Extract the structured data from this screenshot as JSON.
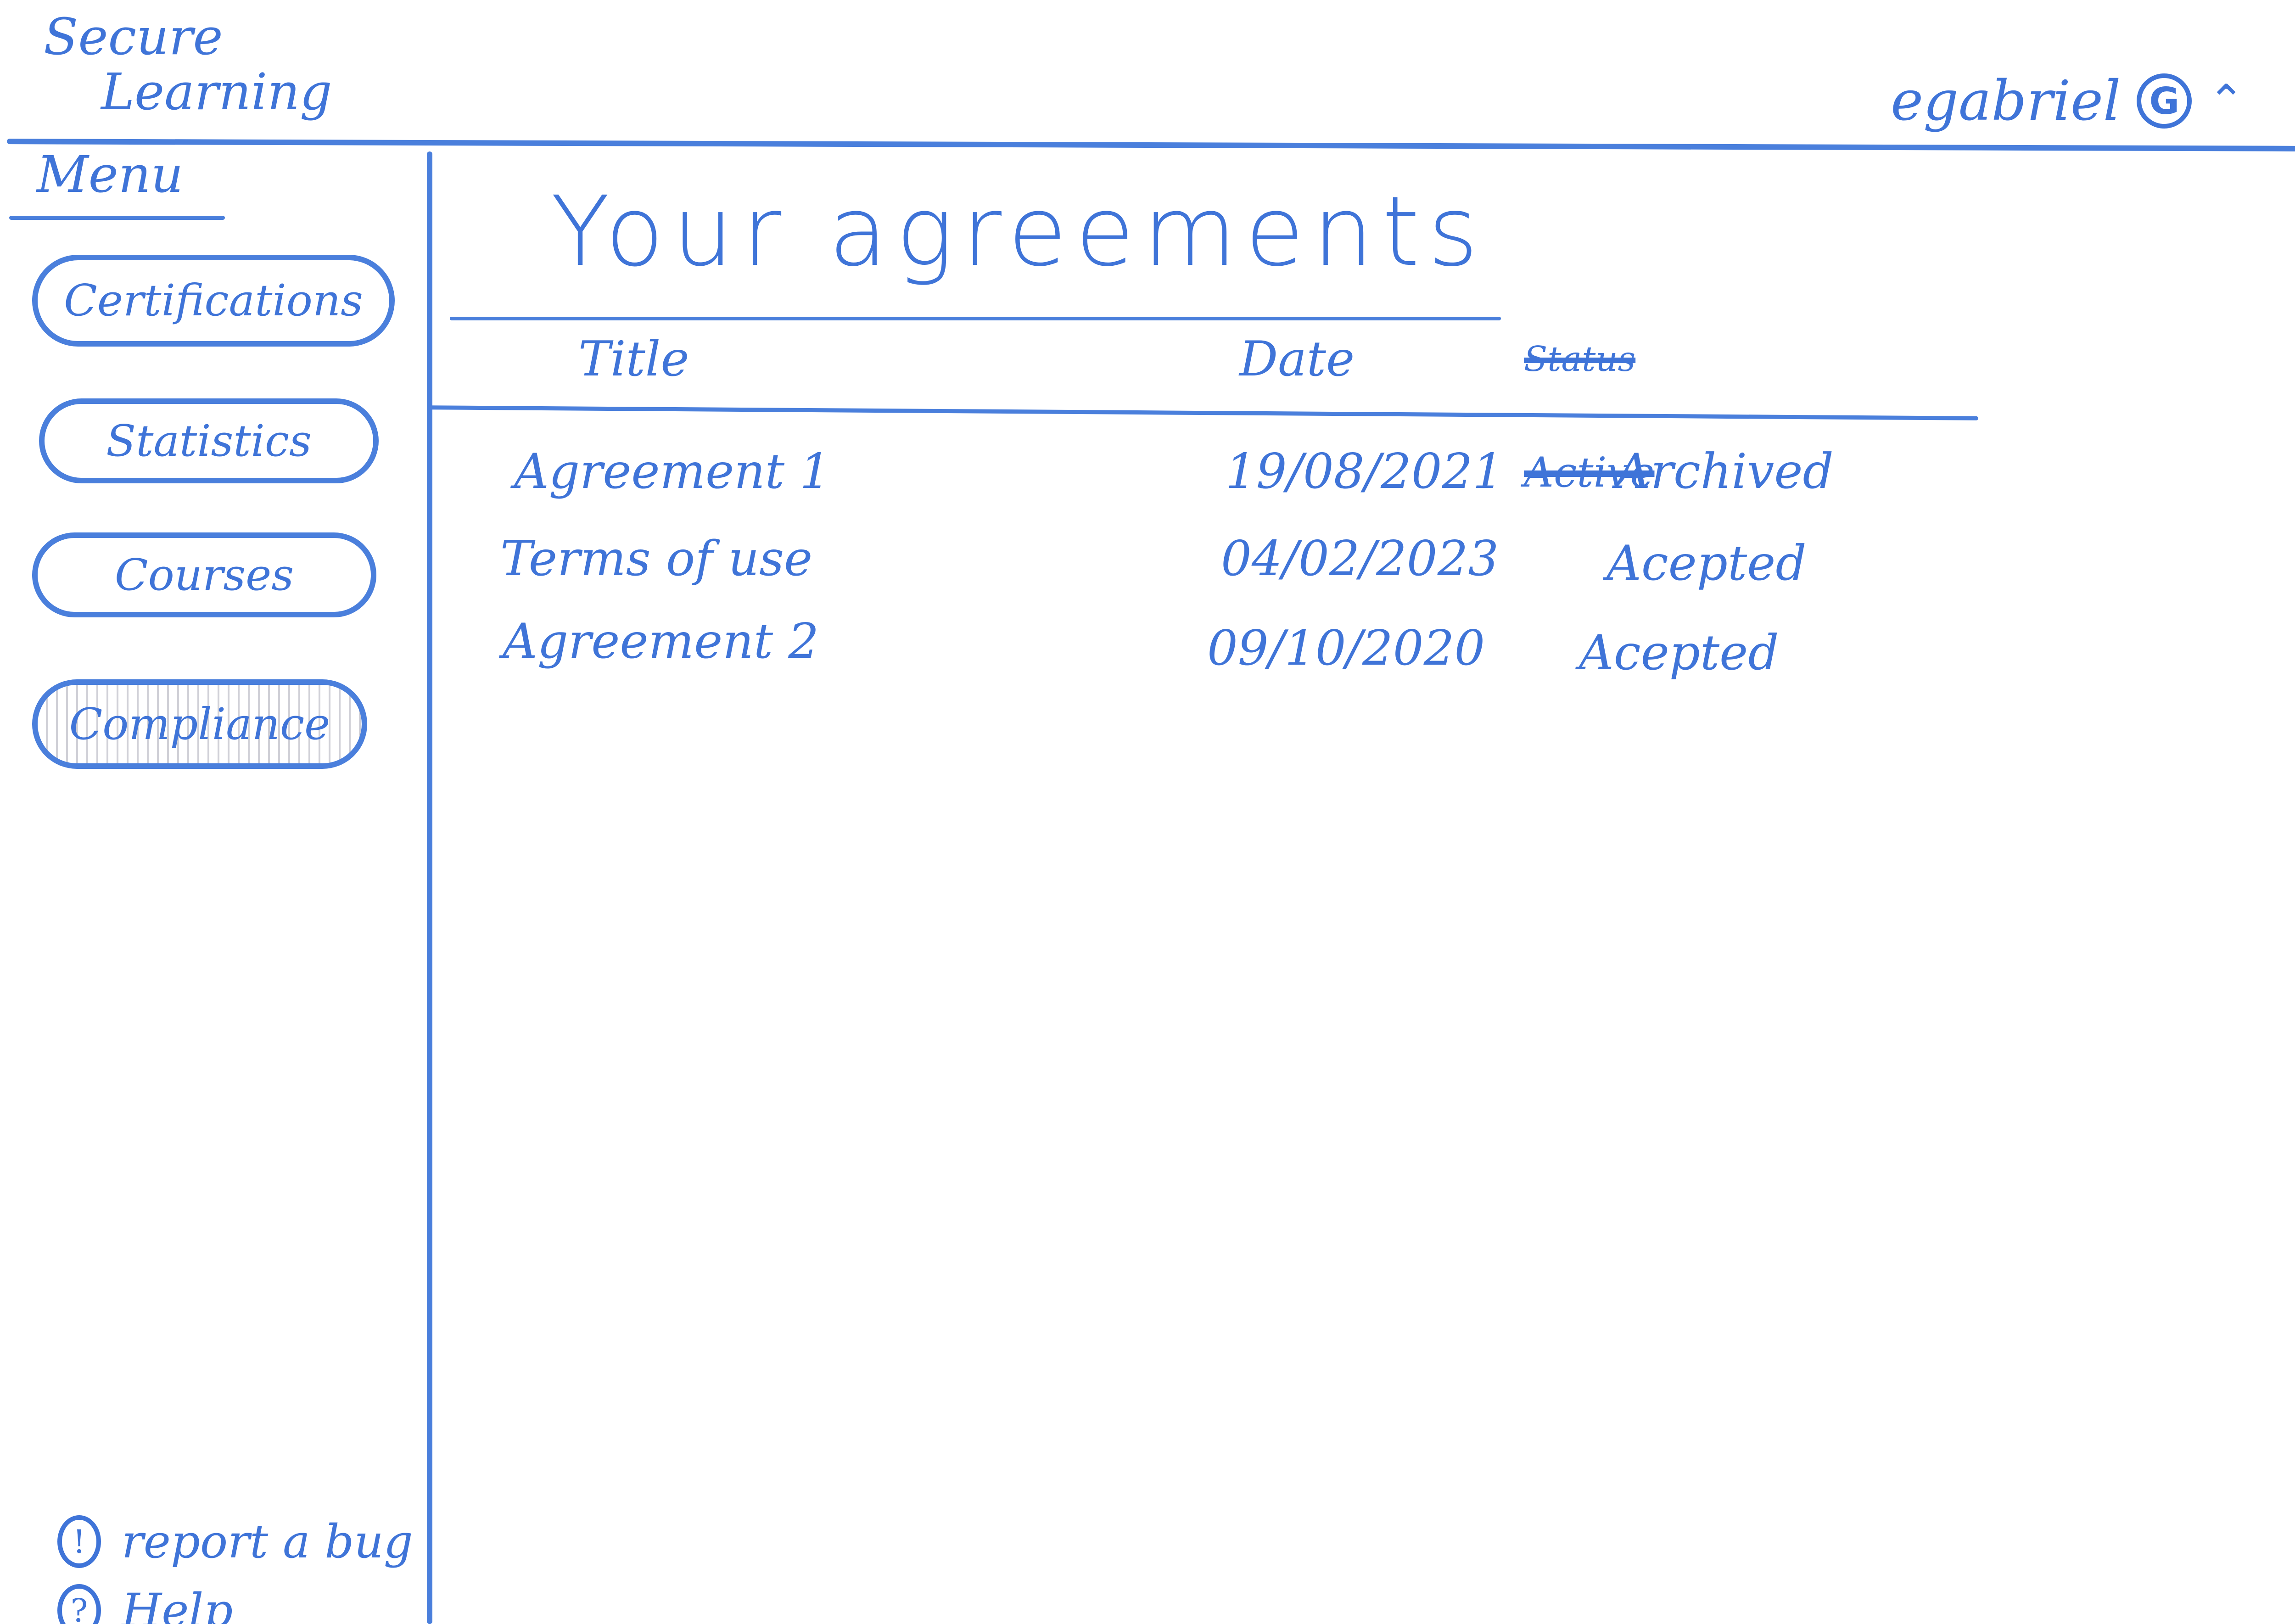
{
  "app": {
    "brand_line1": "Secure",
    "brand_line2": "Learning"
  },
  "header": {
    "username": "egabriel",
    "avatar_initial": "G",
    "chevron_icon": "chevron-up-icon"
  },
  "sidebar": {
    "title": "Menu",
    "items": [
      {
        "label": "Certifications"
      },
      {
        "label": "Statistics"
      },
      {
        "label": "Courses"
      },
      {
        "label": "Compliance",
        "selected": true
      }
    ],
    "footer": {
      "report_icon": "!",
      "report_label": "report a bug",
      "help_icon": "?",
      "help_label": "Help"
    }
  },
  "main": {
    "title": "Your agreements",
    "columns": {
      "title": "Title",
      "date": "Date",
      "status": "Status"
    },
    "rows": [
      {
        "title": "Agreement 1",
        "date": "19/08/2021",
        "status": "Archived",
        "struck": "Active"
      },
      {
        "title": "Terms of use",
        "date": "04/02/2023",
        "status": "Acepted"
      },
      {
        "title": "Agreement 2",
        "date": "09/10/2020",
        "status": "Acepted"
      }
    ]
  },
  "colors": {
    "ink": "#3f74d8"
  }
}
